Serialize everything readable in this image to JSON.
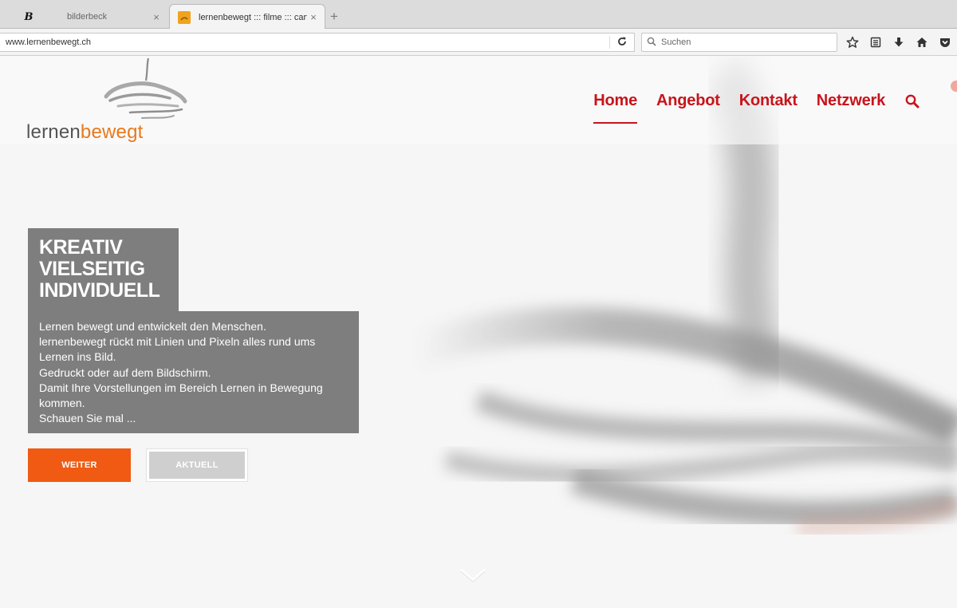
{
  "browser": {
    "tabs": [
      {
        "label": "bilderbeck",
        "favicon": "B",
        "active": false
      },
      {
        "label": "lernenbewegt ::: filme ::: carto",
        "active": true
      }
    ],
    "close_glyph": "×",
    "new_tab_glyph": "+",
    "url": "www.lernenbewegt.ch",
    "reload_icon": "reload-icon",
    "search_placeholder": "Suchen",
    "toolbar_icons": [
      "bookmark-star-icon",
      "reading-list-icon",
      "download-icon",
      "home-icon",
      "pocket-icon"
    ]
  },
  "site": {
    "logo": {
      "text_part1": "lernen",
      "text_part2": "bewegt"
    },
    "nav": {
      "items": [
        {
          "label": "Home",
          "active": true
        },
        {
          "label": "Angebot",
          "active": false
        },
        {
          "label": "Kontakt",
          "active": false
        },
        {
          "label": "Netzwerk",
          "active": false
        }
      ],
      "search_icon": "search-icon"
    },
    "hero": {
      "title_lines": [
        "KREATIV",
        "VIELSEITIG",
        "INDIVIDUELL"
      ],
      "text_lines": [
        "Lernen bewegt und entwickelt den Menschen.",
        "lernenbewegt rückt mit Linien und Pixeln alles rund ums",
        "Lernen ins Bild.",
        "Gedruckt oder auf dem Bildschirm.",
        "Damit Ihre Vorstellungen im Bereich Lernen in Bewegung",
        "kommen.",
        "Schauen Sie mal ..."
      ],
      "primary_button": "WEITER",
      "secondary_button": "AKTUELL"
    },
    "scroll_icon": "chevron-down-icon"
  },
  "colors": {
    "nav_red": "#c8141b",
    "logo_orange": "#e8791b",
    "button_orange": "#f05a12",
    "overlay_grey": "#7e7e7e"
  }
}
